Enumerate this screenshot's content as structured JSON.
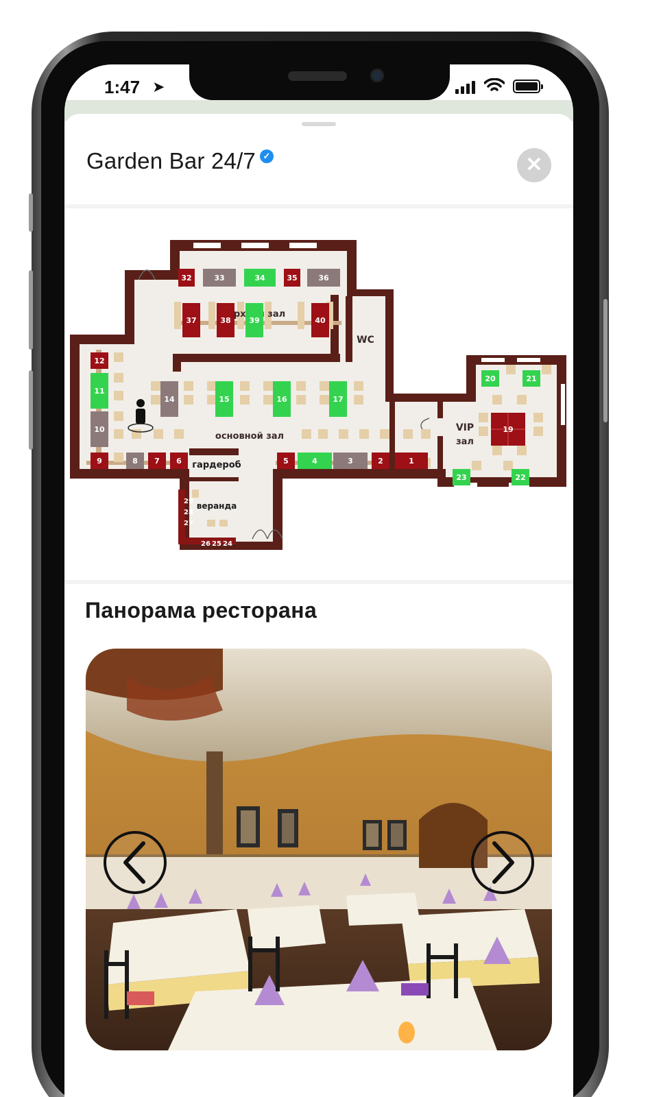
{
  "status_bar": {
    "time": "1:47",
    "location_arrow": "location-arrow-icon"
  },
  "sheet": {
    "title": "Garden Bar 24/7",
    "verified_icon": "verified-check-icon",
    "close_icon": "close-icon"
  },
  "floor_plan": {
    "zones": {
      "upper_hall": "верхний зал",
      "main_hall": "основной зал",
      "wc": "WC",
      "vip": "VIP",
      "vip_hall": "зал",
      "cloakroom": "гардероб",
      "veranda": "веранда"
    },
    "tables": [
      {
        "n": "32",
        "status": "booked"
      },
      {
        "n": "33",
        "status": "unavailable"
      },
      {
        "n": "34",
        "status": "free"
      },
      {
        "n": "35",
        "status": "booked"
      },
      {
        "n": "36",
        "status": "unavailable"
      },
      {
        "n": "37",
        "status": "booked"
      },
      {
        "n": "38",
        "status": "booked"
      },
      {
        "n": "39",
        "status": "free"
      },
      {
        "n": "40",
        "status": "booked"
      },
      {
        "n": "12",
        "status": "booked"
      },
      {
        "n": "11",
        "status": "free"
      },
      {
        "n": "10",
        "status": "unavailable"
      },
      {
        "n": "14",
        "status": "unavailable"
      },
      {
        "n": "15",
        "status": "free"
      },
      {
        "n": "16",
        "status": "free"
      },
      {
        "n": "17",
        "status": "free"
      },
      {
        "n": "9",
        "status": "booked"
      },
      {
        "n": "8",
        "status": "unavailable"
      },
      {
        "n": "7",
        "status": "booked"
      },
      {
        "n": "6",
        "status": "booked"
      },
      {
        "n": "5",
        "status": "booked"
      },
      {
        "n": "4",
        "status": "free"
      },
      {
        "n": "3",
        "status": "unavailable"
      },
      {
        "n": "2",
        "status": "booked"
      },
      {
        "n": "1",
        "status": "booked"
      },
      {
        "n": "20",
        "status": "free"
      },
      {
        "n": "21",
        "status": "free"
      },
      {
        "n": "19",
        "status": "booked"
      },
      {
        "n": "23",
        "status": "free"
      },
      {
        "n": "22",
        "status": "free"
      }
    ],
    "veranda_tables_left": [
      "29",
      "28",
      "27"
    ],
    "veranda_tables_bottom": [
      "26",
      "25",
      "24"
    ],
    "colors": {
      "booked": "#9c1016",
      "free": "#34d34f",
      "unavailable": "#8c7a7a",
      "wall": "#5a1f18",
      "floor": "#f1eee9",
      "chair": "#e5cfa8"
    }
  },
  "panorama": {
    "title": "Панорама ресторана",
    "prev_icon": "chevron-left-icon",
    "next_icon": "chevron-right-icon"
  }
}
